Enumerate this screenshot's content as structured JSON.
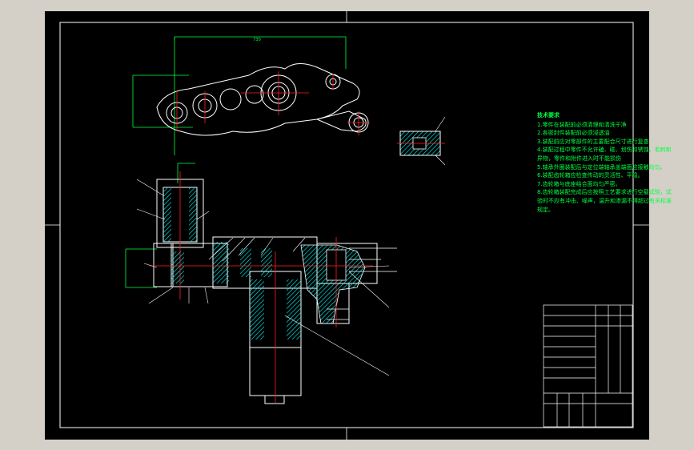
{
  "technical_requirements": {
    "title": "技术要求",
    "items": [
      "1.零件在装配前必须清理和清洗干净",
      "2.各密封件装配前必须浸透油",
      "3.装配前应对零部件的主要配合尺寸进行复查",
      "4.装配过程中零件不允许磕、碰、划伤和锈蚀。毛刺和异物，零件和附件进入时不能损伤",
      "5.轴承外圈装配后与定位端轴承盖端面应接触均匀。",
      "6.装配齿轮箱应检查传动的灵活性、平稳。",
      "7.齿轮箱与底座结合面均匀严密。",
      "8.齿轮箱装配完成后应按照工艺要求进行空载试验，试验时不应有冲击、噪声，温升和渗漏不得超过有关标准规定。"
    ]
  },
  "dimension_label": "730",
  "colors": {
    "background": "#000000",
    "frame": "#ffffff",
    "part_lines": "#ffffff",
    "center_lines": "#ff2020",
    "dimension_lines": "#00ff40",
    "hatch": "#00ffff",
    "note_text": "#00ff40"
  }
}
